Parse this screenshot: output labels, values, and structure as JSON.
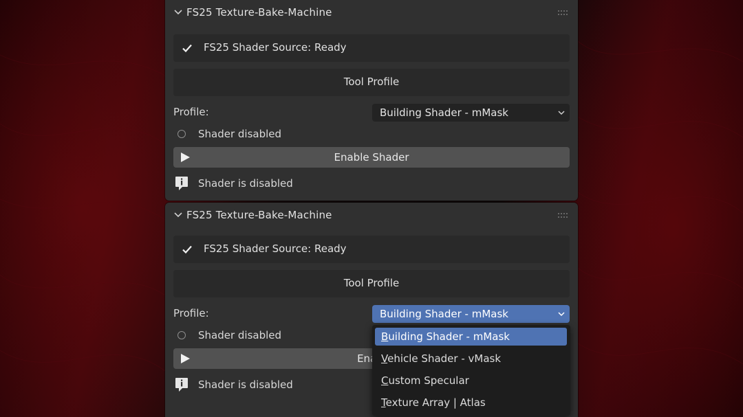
{
  "colors": {
    "panel": "#303030",
    "box": "#292929",
    "button": "#525252",
    "accent": "#4f73b3",
    "dropdown_bg": "#1d1d1d"
  },
  "panels": [
    {
      "title": "FS25 Texture-Bake-Machine",
      "status": "FS25 Shader Source: Ready",
      "tool_profile": "Tool Profile",
      "profile_label": "Profile:",
      "profile_value": "Building Shader - mMask",
      "shader_state": "Shader disabled",
      "enable_button": "Enable Shader",
      "info": "Shader is disabled"
    },
    {
      "title": "FS25 Texture-Bake-Machine",
      "status": "FS25 Shader Source: Ready",
      "tool_profile": "Tool Profile",
      "profile_label": "Profile:",
      "profile_value": "Building Shader - mMask",
      "shader_state": "Shader disabled",
      "enable_button": "Enabl",
      "info": "Shader is disabled"
    }
  ],
  "dropdown": {
    "options": [
      {
        "first": "B",
        "rest": "uilding Shader - mMask",
        "selected": true
      },
      {
        "first": "V",
        "rest": "ehicle Shader - vMask",
        "selected": false
      },
      {
        "first": "C",
        "rest": "ustom Specular",
        "selected": false
      },
      {
        "first": "T",
        "rest": "exture Array | Atlas",
        "selected": false
      }
    ]
  },
  "icons": {
    "collapse": "chevron-down-icon",
    "grip": "drag-grip-icon",
    "check": "checkmark-icon",
    "radio": "radio-icon",
    "play": "play-icon",
    "info": "info-icon",
    "select_arrow": "chevron-down-icon"
  }
}
